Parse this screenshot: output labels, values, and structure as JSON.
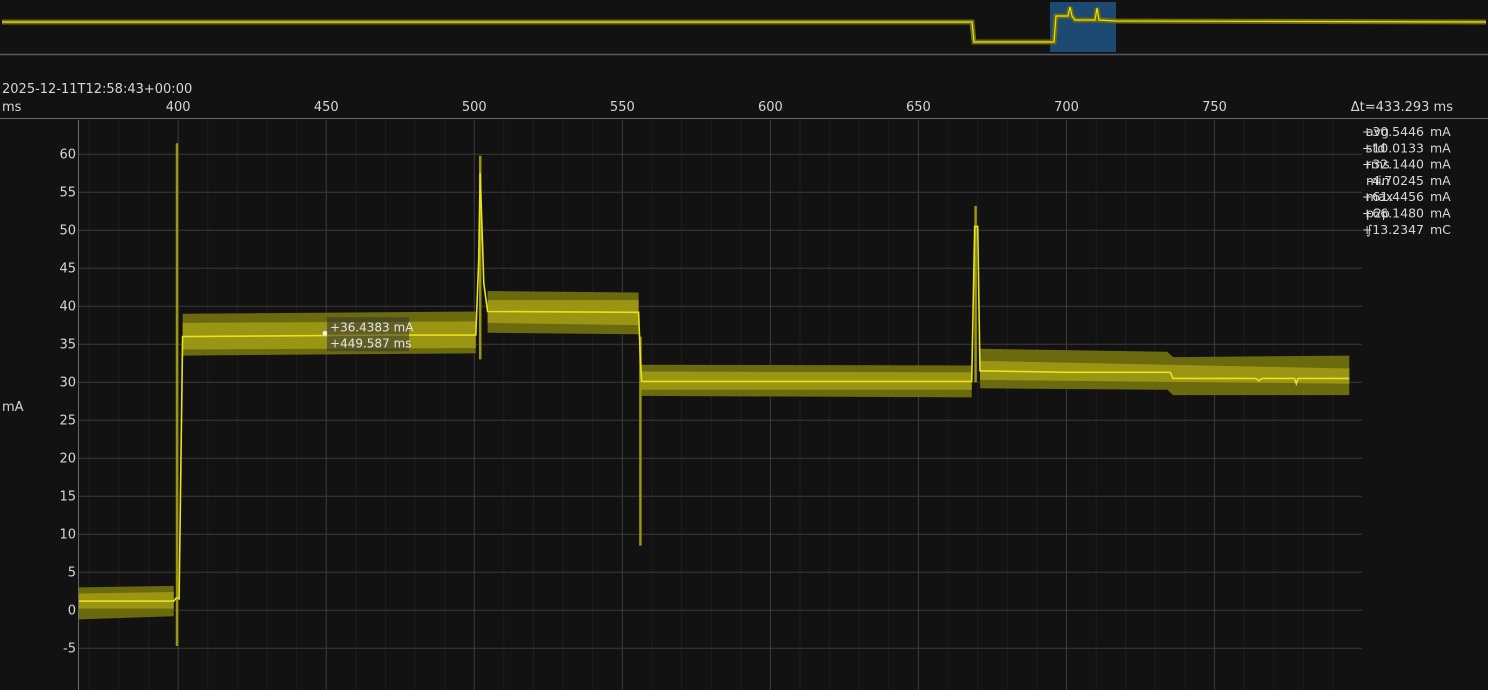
{
  "header": {
    "timestamp": "2025-12-11T12:58:43+00:00",
    "x_unit": "ms",
    "delta": "Δt=433.293 ms",
    "y_unit": "mA"
  },
  "stats": [
    {
      "label": "avg",
      "value": "+30.5446",
      "unit": "mA"
    },
    {
      "label": "std",
      "value": "+10.0133",
      "unit": "mA"
    },
    {
      "label": "rms",
      "value": "+32.1440",
      "unit": "mA"
    },
    {
      "label": "min",
      "value": "-4.70245",
      "unit": "mA"
    },
    {
      "label": "max",
      "value": "+61.4456",
      "unit": "mA"
    },
    {
      "label": "p2p",
      "value": "+66.1480",
      "unit": "mA"
    },
    {
      "label": "∫",
      "value": "+13.2347",
      "unit": "mC"
    }
  ],
  "cursor": {
    "x": 449.587,
    "y": 36.4383,
    "y_label": "+36.4383 mA",
    "x_label": "+449.587 ms"
  },
  "colors": {
    "trace": "#e8e31a",
    "envelope_outer": "#6b6a0e",
    "envelope_inner": "#9a9614",
    "grid": "#3a3a3a",
    "overview_selection": "#1d4a73",
    "background": "#121212"
  },
  "chart_data": {
    "type": "line",
    "xlabel": "ms",
    "ylabel": "mA",
    "x_ticks": [
      400,
      450,
      500,
      550,
      600,
      650,
      700,
      750
    ],
    "y_ticks": [
      -5,
      0,
      5,
      10,
      15,
      20,
      25,
      30,
      35,
      40,
      45,
      50,
      55,
      60
    ],
    "xlim": [
      366.5,
      799.8
    ],
    "ylim": [
      -10.5,
      64.5
    ],
    "grid": true,
    "series": [
      {
        "mean": [
          [
            366.5,
            1.2
          ],
          [
            398.5,
            1.2
          ],
          [
            399.3,
            1.6
          ],
          [
            399.8,
            1.6
          ],
          [
            400.3,
            1.5
          ],
          [
            401.5,
            36.0
          ],
          [
            470.0,
            36.2
          ],
          [
            500.5,
            36.2
          ],
          [
            501.5,
            46.0
          ],
          [
            502.0,
            57.5
          ],
          [
            503.2,
            43.0
          ],
          [
            504.5,
            39.3
          ],
          [
            555.5,
            39.2
          ],
          [
            556.0,
            34.0
          ],
          [
            556.5,
            30.1
          ],
          [
            668.0,
            30.1
          ],
          [
            669.0,
            50.5
          ],
          [
            670.0,
            50.5
          ],
          [
            670.8,
            31.5
          ],
          [
            700.0,
            31.3
          ],
          [
            735.0,
            31.3
          ],
          [
            736.0,
            30.5
          ],
          [
            764.0,
            30.5
          ],
          [
            765.0,
            30.2
          ],
          [
            766.0,
            30.5
          ],
          [
            777.0,
            30.5
          ],
          [
            777.6,
            29.8
          ],
          [
            778.2,
            30.5
          ],
          [
            795.5,
            30.5
          ]
        ],
        "inner": [
          [
            [
              366.5,
              0.2
            ],
            [
              398.5,
              0.2
            ]
          ],
          [
            [
              366.5,
              2.2
            ],
            [
              398.5,
              2.4
            ]
          ],
          [
            [
              401.5,
              34.3
            ],
            [
              500.5,
              34.5
            ]
          ],
          [
            [
              401.5,
              37.8
            ],
            [
              500.5,
              38.0
            ]
          ],
          [
            [
              504.5,
              37.8
            ],
            [
              555.5,
              37.5
            ]
          ],
          [
            [
              504.5,
              40.8
            ],
            [
              555.5,
              40.8
            ]
          ],
          [
            [
              556.5,
              29.0
            ],
            [
              668.0,
              29.0
            ]
          ],
          [
            [
              556.5,
              31.4
            ],
            [
              668.0,
              31.3
            ]
          ],
          [
            [
              670.8,
              30.3
            ],
            [
              795.5,
              29.8
            ]
          ],
          [
            [
              670.8,
              32.8
            ],
            [
              795.5,
              31.8
            ]
          ]
        ],
        "outer": [
          [
            [
              366.5,
              -1.2
            ],
            [
              398.5,
              -0.8
            ]
          ],
          [
            [
              366.5,
              3.0
            ],
            [
              398.5,
              3.2
            ]
          ],
          [
            [
              401.5,
              33.5
            ],
            [
              500.5,
              33.8
            ]
          ],
          [
            [
              401.5,
              39.0
            ],
            [
              500.5,
              39.3
            ]
          ],
          [
            [
              504.5,
              36.5
            ],
            [
              555.5,
              36.3
            ]
          ],
          [
            [
              504.5,
              42.0
            ],
            [
              555.5,
              41.8
            ]
          ],
          [
            [
              556.5,
              28.2
            ],
            [
              668.0,
              28.0
            ]
          ],
          [
            [
              556.5,
              32.3
            ],
            [
              668.0,
              32.2
            ]
          ],
          [
            [
              670.8,
              29.2
            ],
            [
              734.0,
              29.0
            ],
            [
              736.0,
              28.3
            ],
            [
              795.5,
              28.3
            ]
          ],
          [
            [
              670.8,
              34.4
            ],
            [
              734.0,
              34.0
            ],
            [
              736.0,
              33.3
            ],
            [
              795.5,
              33.5
            ]
          ]
        ],
        "spikes": [
          {
            "x": 399.6,
            "low": -4.70245,
            "high": 61.4456
          },
          {
            "x": 502.0,
            "low": 33.0,
            "high": 59.8
          },
          {
            "x": 556.1,
            "low": 8.5,
            "high": 36.0
          },
          {
            "x": 669.3,
            "low": 30.0,
            "high": 53.2
          }
        ]
      }
    ]
  }
}
